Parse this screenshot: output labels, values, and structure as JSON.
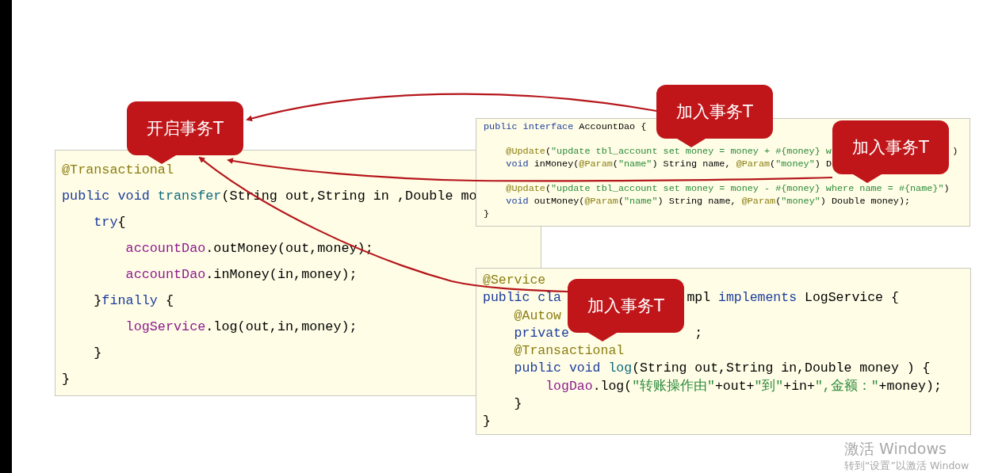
{
  "slide": {
    "code_boxes": [
      {
        "lines": [
          {
            "segs": [
              [
                {
                  "text": "@Transactional",
                  "kind": "ann"
                }
              ]
            ]
          },
          {
            "segs": [
              [
                {
                  "text": "public void ",
                  "kind": "kw"
                },
                {
                  "text": "transfer",
                  "kind": "fn"
                },
                {
                  "text": "(String out,String in ,Double mo",
                  "kind": "p"
                }
              ]
            ]
          },
          {
            "segs": [
              [
                {
                  "text": "    try",
                  "kind": "kw"
                },
                {
                  "text": "{",
                  "kind": "p"
                }
              ]
            ]
          },
          {
            "segs": [
              [
                {
                  "text": "        accountDao",
                  "kind": "fld"
                },
                {
                  "text": ".outMoney(out,money);",
                  "kind": "p"
                }
              ]
            ]
          },
          {
            "segs": [
              [
                {
                  "text": "        accountDao",
                  "kind": "fld"
                },
                {
                  "text": ".inMoney(in,money);",
                  "kind": "p"
                }
              ]
            ]
          },
          {
            "segs": [
              [
                {
                  "text": "    }",
                  "kind": "p"
                },
                {
                  "text": "finally",
                  "kind": "kw"
                },
                {
                  "text": " {",
                  "kind": "p"
                }
              ]
            ]
          },
          {
            "segs": [
              [
                {
                  "text": "        logService",
                  "kind": "fld"
                },
                {
                  "text": ".log(out,in,money);",
                  "kind": "p"
                }
              ]
            ]
          },
          {
            "segs": [
              [
                {
                  "text": "    }",
                  "kind": "p"
                }
              ]
            ]
          },
          {
            "segs": [
              [
                {
                  "text": "}",
                  "kind": "p"
                }
              ]
            ]
          }
        ]
      },
      {
        "lines": [
          {
            "segs": [
              [
                {
                  "text": "public interface ",
                  "kind": "kw"
                },
                {
                  "text": "AccountDao {",
                  "kind": "p"
                }
              ]
            ]
          },
          {
            "kind": "blank"
          },
          {
            "segs": [
              [
                {
                  "text": "    @Update",
                  "kind": "ann"
                },
                {
                  "text": "(",
                  "kind": "p"
                },
                {
                  "text": "\"update tbl_account set money = money + #{money} w",
                  "kind": "str"
                }
              ],
              [
                {
                  "text": ")",
                  "kind": "p"
                }
              ]
            ]
          },
          {
            "segs": [
              [
                {
                  "text": "    void ",
                  "kind": "kw"
                },
                {
                  "text": "inMoney(",
                  "kind": "p"
                },
                {
                  "text": "@Param",
                  "kind": "ann"
                },
                {
                  "text": "(",
                  "kind": "p"
                },
                {
                  "text": "\"name\"",
                  "kind": "str"
                },
                {
                  "text": ") String name, ",
                  "kind": "p"
                },
                {
                  "text": "@Param",
                  "kind": "ann"
                },
                {
                  "text": "(",
                  "kind": "p"
                },
                {
                  "text": "\"money\"",
                  "kind": "str"
                },
                {
                  "text": ") D",
                  "kind": "p"
                }
              ]
            ]
          },
          {
            "kind": "blank"
          },
          {
            "segs": [
              [
                {
                  "text": "    @Update",
                  "kind": "ann"
                },
                {
                  "text": "(",
                  "kind": "p"
                },
                {
                  "text": "\"update tbl_account set money = money - #{money} where name = #{name}\"",
                  "kind": "str"
                },
                {
                  "text": ")",
                  "kind": "p"
                }
              ]
            ]
          },
          {
            "segs": [
              [
                {
                  "text": "    void ",
                  "kind": "kw"
                },
                {
                  "text": "outMoney(",
                  "kind": "p"
                },
                {
                  "text": "@Param",
                  "kind": "ann"
                },
                {
                  "text": "(",
                  "kind": "p"
                },
                {
                  "text": "\"name\"",
                  "kind": "str"
                },
                {
                  "text": ") String name, ",
                  "kind": "p"
                },
                {
                  "text": "@Param",
                  "kind": "ann"
                },
                {
                  "text": "(",
                  "kind": "p"
                },
                {
                  "text": "\"money\"",
                  "kind": "str"
                },
                {
                  "text": ") Double money);",
                  "kind": "p"
                }
              ]
            ]
          },
          {
            "segs": [
              [
                {
                  "text": "}",
                  "kind": "p"
                }
              ]
            ]
          }
        ]
      },
      {
        "lines": [
          {
            "segs": [
              [
                {
                  "text": "@Service",
                  "kind": "ann"
                }
              ]
            ]
          },
          {
            "segs": [
              [
                {
                  "text": "public cla",
                  "kind": "kw"
                }
              ],
              [
                {
                  "text": "mpl ",
                  "kind": "p"
                },
                {
                  "text": "implements ",
                  "kind": "kw"
                },
                {
                  "text": "LogService {",
                  "kind": "p"
                }
              ]
            ]
          },
          {
            "segs": [
              [
                {
                  "text": "    @Autow",
                  "kind": "ann"
                }
              ]
            ]
          },
          {
            "segs": [
              [
                {
                  "text": "    private",
                  "kind": "kw"
                }
              ],
              [
                {
                  "text": ";",
                  "kind": "p"
                }
              ]
            ]
          },
          {
            "segs": [
              [
                {
                  "text": "    @Transactional",
                  "kind": "ann"
                }
              ]
            ]
          },
          {
            "segs": [
              [
                {
                  "text": "    public void ",
                  "kind": "kw"
                },
                {
                  "text": "log",
                  "kind": "fn"
                },
                {
                  "text": "(String out,String in,Double money ) {",
                  "kind": "p"
                }
              ]
            ]
          },
          {
            "segs": [
              [
                {
                  "text": "        logDao",
                  "kind": "fld"
                },
                {
                  "text": ".log(",
                  "kind": "p"
                },
                {
                  "text": "\"转账操作由\"",
                  "kind": "str"
                },
                {
                  "text": "+out+",
                  "kind": "p"
                },
                {
                  "text": "\"到\"",
                  "kind": "str"
                },
                {
                  "text": "+in+",
                  "kind": "p"
                },
                {
                  "text": "\",金额：\"",
                  "kind": "str"
                },
                {
                  "text": "+money);",
                  "kind": "p"
                }
              ]
            ]
          },
          {
            "segs": [
              [
                {
                  "text": "    }",
                  "kind": "p"
                }
              ]
            ]
          },
          {
            "segs": [
              [
                {
                  "text": "}",
                  "kind": "p"
                }
              ]
            ]
          }
        ]
      }
    ],
    "callouts": [
      {
        "text": "开启事务T"
      },
      {
        "text": "加入事务T"
      },
      {
        "text": "加入事务T"
      },
      {
        "text": "加入事务T"
      }
    ]
  },
  "os_watermark": {
    "title": "激活 Windows",
    "subtitle": "转到“设置”以激活 Window"
  }
}
